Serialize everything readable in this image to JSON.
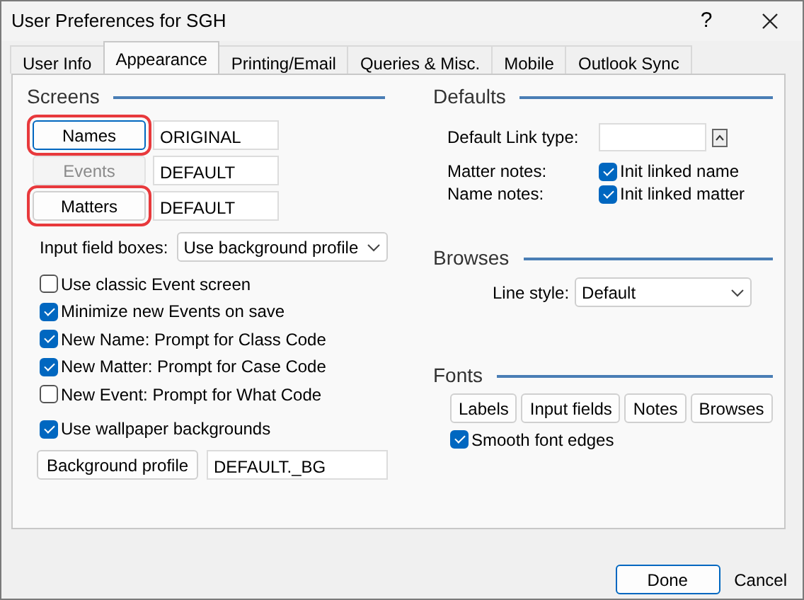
{
  "window": {
    "title": "User Preferences for SGH",
    "help": "?"
  },
  "tabs": [
    {
      "label": "User Info",
      "selected": false
    },
    {
      "label": "Appearance",
      "selected": true
    },
    {
      "label": "Printing/Email",
      "selected": false
    },
    {
      "label": "Queries & Misc.",
      "selected": false
    },
    {
      "label": "Mobile",
      "selected": false
    },
    {
      "label": "Outlook Sync",
      "selected": false
    }
  ],
  "screens": {
    "heading": "Screens",
    "rows": [
      {
        "button": "Names",
        "value": "ORIGINAL",
        "enabled": true,
        "focused": true,
        "highlighted": true
      },
      {
        "button": "Events",
        "value": "DEFAULT",
        "enabled": false,
        "focused": false,
        "highlighted": false
      },
      {
        "button": "Matters",
        "value": "DEFAULT",
        "enabled": true,
        "focused": false,
        "highlighted": true
      }
    ],
    "input_field_boxes": {
      "label": "Input field boxes:",
      "value": "Use background profile"
    },
    "checkboxes": [
      {
        "label": "Use classic Event screen",
        "checked": false
      },
      {
        "label": "Minimize new Events on save",
        "checked": true
      },
      {
        "label": "New Name: Prompt for Class Code",
        "checked": true
      },
      {
        "label": "New Matter: Prompt for Case Code",
        "checked": true
      },
      {
        "label": "New Event: Prompt for What Code",
        "checked": false
      }
    ],
    "wallpaper": {
      "label": "Use wallpaper backgrounds",
      "checked": true
    },
    "background_profile": {
      "button": "Background profile",
      "value": "DEFAULT._BG"
    }
  },
  "defaults": {
    "heading": "Defaults",
    "link_type": {
      "label": "Default Link type:"
    },
    "notes": [
      {
        "label": "Matter notes:",
        "option": "Init linked name",
        "checked": true
      },
      {
        "label": "Name notes:",
        "option": "Init linked matter",
        "checked": true
      }
    ]
  },
  "browses": {
    "heading": "Browses",
    "line_style": {
      "label": "Line style:",
      "value": "Default"
    }
  },
  "fonts": {
    "heading": "Fonts",
    "buttons": [
      "Labels",
      "Input fields",
      "Notes",
      "Browses"
    ],
    "smooth": {
      "label": "Smooth font edges",
      "checked": true
    }
  },
  "footer": [
    {
      "label": "Done",
      "default": true
    },
    {
      "label": "Cancel",
      "default": false
    }
  ]
}
